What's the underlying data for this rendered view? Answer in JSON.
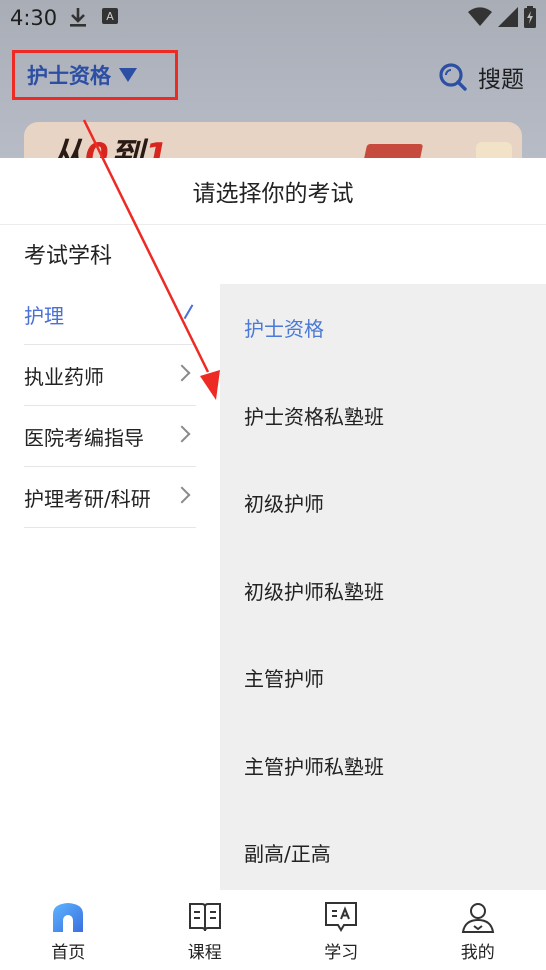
{
  "status": {
    "time": "4:30",
    "badge": "A"
  },
  "header": {
    "exam_selector": "护士资格",
    "search_label": "搜题"
  },
  "banner": {
    "text_prefix": "从",
    "text_zero": "0",
    "text_mid": "到",
    "text_one": "1"
  },
  "panel": {
    "title": "请选择你的考试",
    "subject_heading": "考试学科",
    "subjects": [
      "护理",
      "执业药师",
      "医院考编指导",
      "护理考研/科研"
    ],
    "exams": [
      "护士资格",
      "护士资格私塾班",
      "初级护师",
      "初级护师私塾班",
      "主管护师",
      "主管护师私塾班",
      "副高/正高"
    ]
  },
  "nav": {
    "items": [
      "首页",
      "课程",
      "学习",
      "我的"
    ]
  },
  "colors": {
    "accent": "#4a6fd6",
    "annotation": "#ee2a24"
  }
}
